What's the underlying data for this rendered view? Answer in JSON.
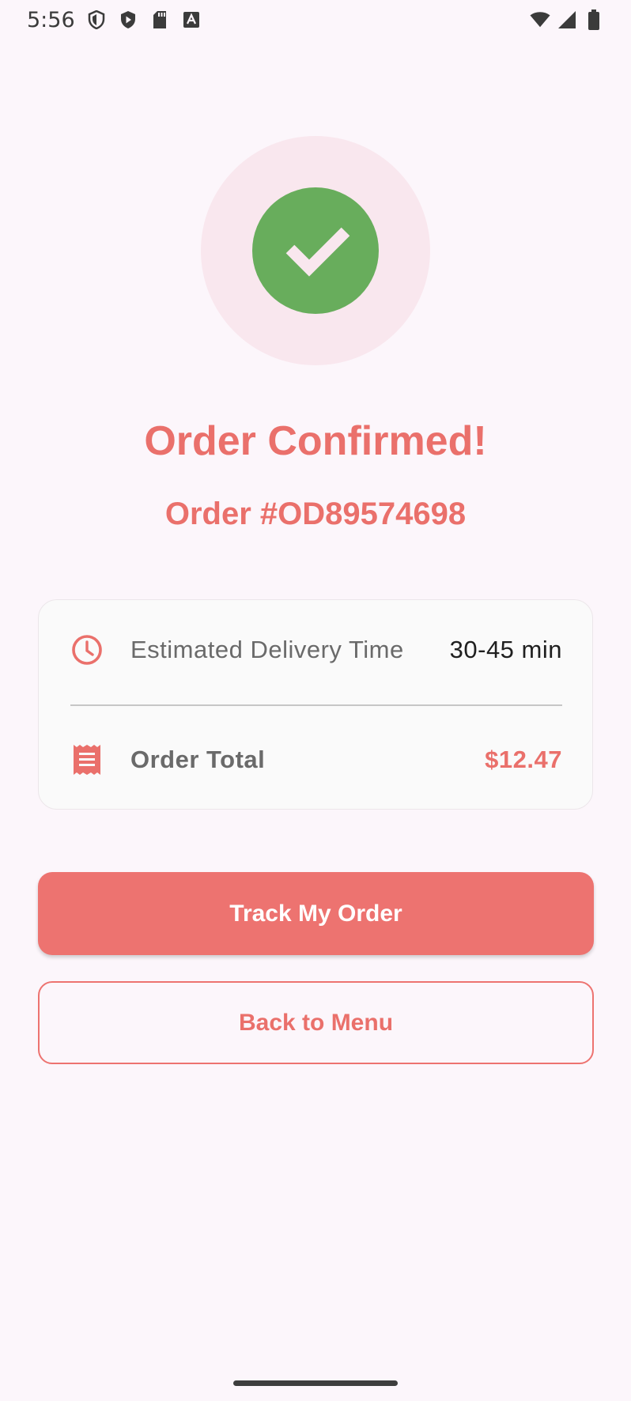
{
  "status_bar": {
    "time": "5:56",
    "left_icons": [
      "shield-icon",
      "play-protect-icon",
      "sd-card-icon",
      "text-a-icon"
    ],
    "right_icons": [
      "wifi-icon",
      "cell-signal-icon",
      "battery-icon"
    ]
  },
  "confirmation": {
    "icon": "check-icon",
    "title": "Order Confirmed!",
    "order_number": "Order #OD89574698"
  },
  "summary_card": {
    "delivery": {
      "icon": "clock-icon",
      "label": "Estimated Delivery Time",
      "value": "30-45 min"
    },
    "total": {
      "icon": "receipt-icon",
      "label": "Order Total",
      "value": "$12.47"
    }
  },
  "actions": {
    "track_label": "Track My Order",
    "back_label": "Back to Menu"
  },
  "colors": {
    "accent": "#ea706b",
    "success": "#68ad5c",
    "background": "#fcf6fb",
    "hero_circle": "#f9e7ee"
  }
}
